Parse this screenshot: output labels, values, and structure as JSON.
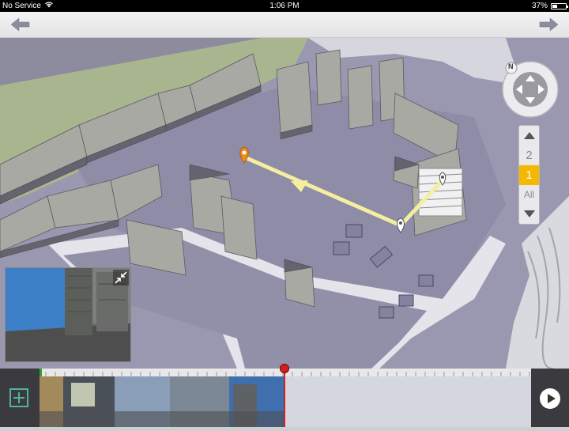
{
  "status_bar": {
    "carrier": "No Service",
    "time": "1:06 PM",
    "battery_percent": "37%",
    "battery_level": 0.37
  },
  "nav_bar": {
    "back_icon": "arrow-left-icon",
    "forward_icon": "arrow-right-icon"
  },
  "map": {
    "start_marker_icon": "location-pin-icon",
    "destination_marker_icon": "location-pin-icon",
    "route_color": "#f3eea0",
    "destination_color": "#f08a1c"
  },
  "compass": {
    "label": "N"
  },
  "floor_selector": {
    "up_icon": "triangle-up-icon",
    "down_icon": "triangle-down-icon",
    "floors": [
      "2",
      "1",
      "All"
    ],
    "active_floor": "1"
  },
  "preview": {
    "collapse_icon": "collapse-arrows-icon"
  },
  "timeline": {
    "add_icon": "plus-icon",
    "play_icon": "play-icon",
    "accent_color": "#d02020"
  }
}
